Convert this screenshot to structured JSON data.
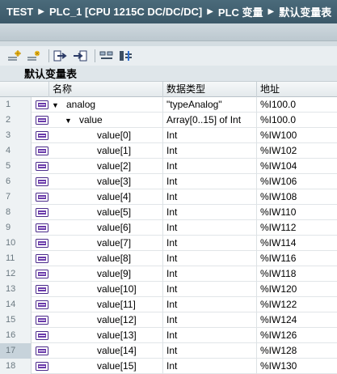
{
  "breadcrumb": [
    "TEST",
    "PLC_1 [CPU 1215C DC/DC/DC]",
    "PLC 变量",
    "默认变量表"
  ],
  "toolbar": {
    "icons": [
      "add-row-icon",
      "insert-row-icon",
      "export-icon",
      "import-icon",
      "monitor-icon",
      "settings-icon"
    ]
  },
  "table": {
    "title": "默认变量表",
    "columns": [
      "名称",
      "数据类型",
      "地址"
    ],
    "rows": [
      {
        "num": "1",
        "name": "analog",
        "type": "\"typeAnalog\"",
        "addr": "%I100.0",
        "level": 0,
        "expanded": true
      },
      {
        "num": "2",
        "name": "value",
        "type": "Array[0..15] of Int",
        "addr": "%I100.0",
        "level": 1,
        "expanded": true
      },
      {
        "num": "3",
        "name": "value[0]",
        "type": "Int",
        "addr": "%IW100",
        "level": 2
      },
      {
        "num": "4",
        "name": "value[1]",
        "type": "Int",
        "addr": "%IW102",
        "level": 2
      },
      {
        "num": "5",
        "name": "value[2]",
        "type": "Int",
        "addr": "%IW104",
        "level": 2
      },
      {
        "num": "6",
        "name": "value[3]",
        "type": "Int",
        "addr": "%IW106",
        "level": 2
      },
      {
        "num": "7",
        "name": "value[4]",
        "type": "Int",
        "addr": "%IW108",
        "level": 2
      },
      {
        "num": "8",
        "name": "value[5]",
        "type": "Int",
        "addr": "%IW110",
        "level": 2
      },
      {
        "num": "9",
        "name": "value[6]",
        "type": "Int",
        "addr": "%IW112",
        "level": 2
      },
      {
        "num": "10",
        "name": "value[7]",
        "type": "Int",
        "addr": "%IW114",
        "level": 2
      },
      {
        "num": "11",
        "name": "value[8]",
        "type": "Int",
        "addr": "%IW116",
        "level": 2
      },
      {
        "num": "12",
        "name": "value[9]",
        "type": "Int",
        "addr": "%IW118",
        "level": 2
      },
      {
        "num": "13",
        "name": "value[10]",
        "type": "Int",
        "addr": "%IW120",
        "level": 2
      },
      {
        "num": "14",
        "name": "value[11]",
        "type": "Int",
        "addr": "%IW122",
        "level": 2
      },
      {
        "num": "15",
        "name": "value[12]",
        "type": "Int",
        "addr": "%IW124",
        "level": 2
      },
      {
        "num": "16",
        "name": "value[13]",
        "type": "Int",
        "addr": "%IW126",
        "level": 2
      },
      {
        "num": "17",
        "name": "value[14]",
        "type": "Int",
        "addr": "%IW128",
        "level": 2,
        "selected": true
      },
      {
        "num": "18",
        "name": "value[15]",
        "type": "Int",
        "addr": "%IW130",
        "level": 2
      }
    ]
  }
}
